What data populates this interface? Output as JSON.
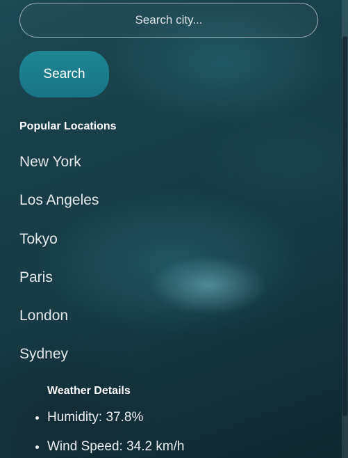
{
  "search": {
    "placeholder": "Search city...",
    "button_label": "Search"
  },
  "popular": {
    "title": "Popular Locations",
    "items": [
      {
        "label": "New York"
      },
      {
        "label": "Los Angeles"
      },
      {
        "label": "Tokyo"
      },
      {
        "label": "Paris"
      },
      {
        "label": "London"
      },
      {
        "label": "Sydney"
      }
    ]
  },
  "weather": {
    "title": "Weather Details",
    "items": [
      {
        "text": "Humidity: 37.8%"
      },
      {
        "text": "Wind Speed: 34.2 km/h"
      }
    ]
  },
  "colors": {
    "accent": "#1f8595",
    "background": "#173b45"
  }
}
